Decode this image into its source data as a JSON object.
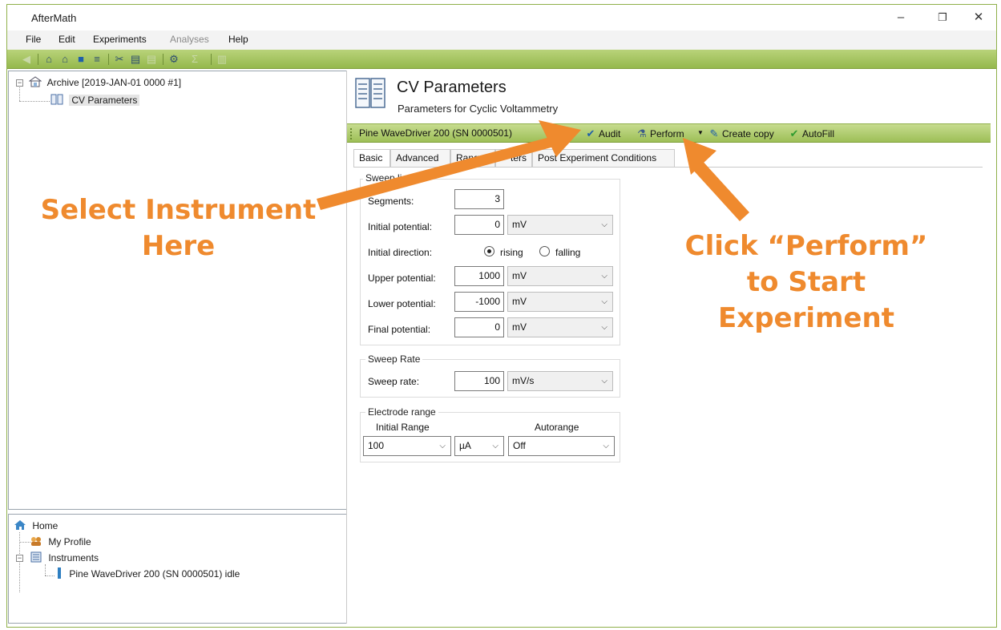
{
  "window": {
    "title": "AfterMath",
    "minimize_glyph": "–",
    "restore_glyph": "❐",
    "close_glyph": "✕"
  },
  "menu": {
    "file": "File",
    "edit": "Edit",
    "experiments": "Experiments",
    "analyses": "Analyses",
    "help": "Help"
  },
  "toolbar_icons": [
    "back-icon",
    "archive-home-icon",
    "home-icon",
    "save-icon",
    "print-icon",
    "cut-icon",
    "copy-icon",
    "paste-icon",
    "tools-icon",
    "sum-icon",
    "chart-icon"
  ],
  "archive_tree": {
    "root_label": "Archive [2019-JAN-01 0000 #1]",
    "child_label": "CV Parameters"
  },
  "home_tree": {
    "home_label": "Home",
    "profile_label": "My Profile",
    "instruments_label": "Instruments",
    "instrument_item": "Pine WaveDriver 200 (SN 0000501) idle"
  },
  "header": {
    "title": "CV Parameters",
    "subtitle": "Parameters for Cyclic Voltammetry"
  },
  "instrument_bar": {
    "selected_instrument": "Pine WaveDriver 200 (SN 0000501)",
    "audit": "Audit",
    "perform": "Perform",
    "create_copy": "Create copy",
    "autofill": "AutoFill"
  },
  "tabs": [
    "Basic",
    "Advanced",
    "Range",
    "ters",
    "Post Experiment Conditions"
  ],
  "sweep_limits": {
    "legend": "Sweep li",
    "segments_label": "Segments:",
    "segments_value": "3",
    "initial_potential_label": "Initial potential:",
    "initial_potential_value": "0",
    "initial_potential_unit": "mV",
    "initial_direction_label": "Initial direction:",
    "rising_label": "rising",
    "falling_label": "falling",
    "upper_potential_label": "Upper potential:",
    "upper_potential_value": "1000",
    "upper_potential_unit": "mV",
    "lower_potential_label": "Lower potential:",
    "lower_potential_value": "-1000",
    "lower_potential_unit": "mV",
    "final_potential_label": "Final potential:",
    "final_potential_value": "0",
    "final_potential_unit": "mV"
  },
  "sweep_rate": {
    "legend": "Sweep Rate",
    "label": "Sweep rate:",
    "value": "100",
    "unit": "mV/s"
  },
  "electrode_range": {
    "legend": "Electrode range",
    "initial_range_label": "Initial Range",
    "autorange_label": "Autorange",
    "initial_range_value": "100",
    "initial_range_unit": "µA",
    "autorange_value": "Off"
  },
  "annotations": {
    "select_line1": "Select Instrument",
    "select_line2": "Here",
    "perform_line1": "Click “Perform”",
    "perform_line2": "to Start",
    "perform_line3": "Experiment",
    "color": "#ef8a2e"
  }
}
